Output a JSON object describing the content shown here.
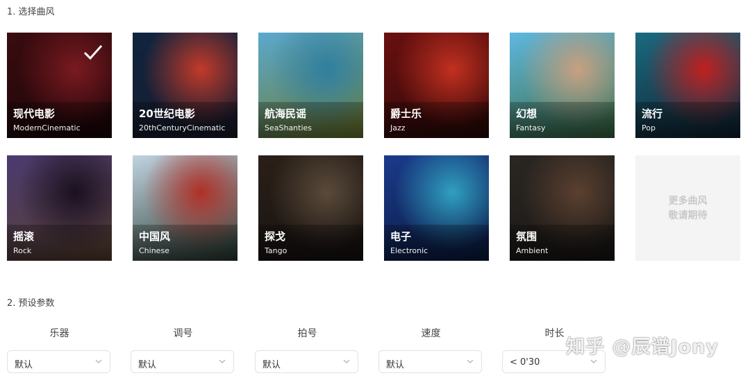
{
  "section1": {
    "title": "1. 选择曲风"
  },
  "styles": [
    {
      "zh": "现代电影",
      "en": "ModernCinematic",
      "selected": true,
      "colors": [
        "#3a0c10",
        "#7a1a20",
        "#1a0508"
      ]
    },
    {
      "zh": "20世纪电影",
      "en": "20thCenturyCinematic",
      "selected": false,
      "colors": [
        "#0f2540",
        "#c23a2a",
        "#1a1a2a"
      ]
    },
    {
      "zh": "航海民谣",
      "en": "SeaShanties",
      "selected": false,
      "colors": [
        "#5aa8d0",
        "#2f7fa0",
        "#6d7a2a"
      ]
    },
    {
      "zh": "爵士乐",
      "en": "Jazz",
      "selected": false,
      "colors": [
        "#6a1010",
        "#c23020",
        "#2a0808"
      ]
    },
    {
      "zh": "幻想",
      "en": "Fantasy",
      "selected": false,
      "colors": [
        "#5fb8e0",
        "#c8a080",
        "#3a6a40"
      ]
    },
    {
      "zh": "流行",
      "en": "Pop",
      "selected": false,
      "colors": [
        "#1a6a80",
        "#c02020",
        "#102030"
      ]
    },
    {
      "zh": "摇滚",
      "en": "Rock",
      "selected": false,
      "colors": [
        "#4a3a70",
        "#1a1020",
        "#5a4030"
      ]
    },
    {
      "zh": "中国风",
      "en": "Chinese",
      "selected": false,
      "colors": [
        "#c0d4e0",
        "#b03028",
        "#2a3a30"
      ]
    },
    {
      "zh": "探戈",
      "en": "Tango",
      "selected": false,
      "colors": [
        "#2a2018",
        "#5a4a3a",
        "#151010"
      ]
    },
    {
      "zh": "电子",
      "en": "Electronic",
      "selected": false,
      "colors": [
        "#1a3a8a",
        "#30a0c0",
        "#0a1a40"
      ]
    },
    {
      "zh": "氛围",
      "en": "Ambient",
      "selected": false,
      "colors": [
        "#2a2622",
        "#5a4030",
        "#1a1614"
      ]
    }
  ],
  "more": {
    "line1": "更多曲风",
    "line2": "敬请期待"
  },
  "section2": {
    "title": "2. 预设参数"
  },
  "params": [
    {
      "label": "乐器",
      "value": "默认"
    },
    {
      "label": "调号",
      "value": "默认"
    },
    {
      "label": "拍号",
      "value": "默认"
    },
    {
      "label": "速度",
      "value": "默认"
    },
    {
      "label": "时长",
      "value": "< 0'30"
    }
  ],
  "watermark": "知乎 @辰谱Jony"
}
